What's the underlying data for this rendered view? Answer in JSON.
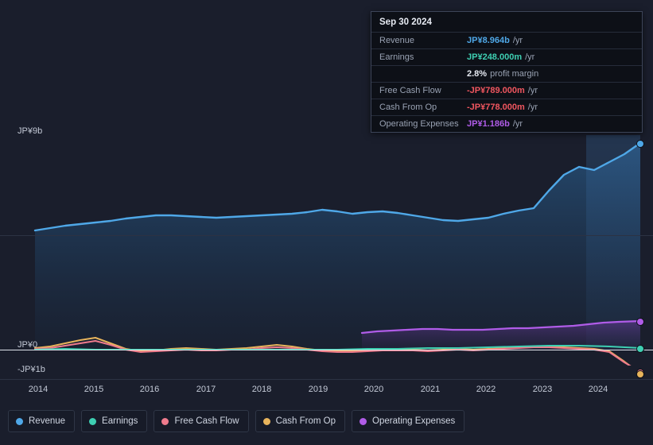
{
  "tooltip": {
    "date": "Sep 30 2024",
    "rows": [
      {
        "label": "Revenue",
        "value": "JP¥8.964b",
        "unit": "/yr",
        "color": "#4fa8e8"
      },
      {
        "label": "Earnings",
        "value": "JP¥248.000m",
        "unit": "/yr",
        "color": "#3ecfb2"
      },
      {
        "label": "",
        "value": "2.8%",
        "unit": "profit margin",
        "color": "#e6eaf2"
      },
      {
        "label": "Free Cash Flow",
        "value": "-JP¥789.000m",
        "unit": "/yr",
        "color": "#f0565f"
      },
      {
        "label": "Cash From Op",
        "value": "-JP¥778.000m",
        "unit": "/yr",
        "color": "#f0565f"
      },
      {
        "label": "Operating Expenses",
        "value": "JP¥1.186b",
        "unit": "/yr",
        "color": "#b05ce8"
      }
    ]
  },
  "axis": {
    "y_top": "JP¥9b",
    "y_zero": "JP¥0",
    "y_bottom": "-JP¥1b",
    "x_ticks": [
      "2014",
      "2015",
      "2016",
      "2017",
      "2018",
      "2019",
      "2020",
      "2021",
      "2022",
      "2023",
      "2024"
    ]
  },
  "legend": [
    {
      "label": "Revenue",
      "color": "#4fa8e8"
    },
    {
      "label": "Earnings",
      "color": "#3ecfb2"
    },
    {
      "label": "Free Cash Flow",
      "color": "#ef7b8d"
    },
    {
      "label": "Cash From Op",
      "color": "#e8b45c"
    },
    {
      "label": "Operating Expenses",
      "color": "#b05ce8"
    }
  ],
  "chart_data": {
    "type": "line",
    "title": "",
    "xlabel": "",
    "ylabel": "",
    "ylim": [
      -1000000000,
      9000000000
    ],
    "y_axis_ticks": [
      "JP¥9b",
      "JP¥0",
      "-JP¥1b"
    ],
    "grid": false,
    "legend_position": "bottom",
    "currency": "JP¥",
    "x": [
      "2014",
      "2015",
      "2016",
      "2017",
      "2018",
      "2019",
      "2020",
      "2021",
      "2022",
      "2023",
      "2024",
      "2024-09-30"
    ],
    "series": [
      {
        "name": "Revenue",
        "color": "#4fa8e8",
        "values": [
          4.85,
          5.05,
          5.3,
          5.25,
          5.35,
          5.45,
          5.5,
          5.45,
          5.35,
          5.9,
          7.6,
          8.964
        ],
        "unit": "JP¥b"
      },
      {
        "name": "Earnings",
        "color": "#3ecfb2",
        "values": [
          0.02,
          0.05,
          0.03,
          0.02,
          0.04,
          0.05,
          0.03,
          0.06,
          0.1,
          0.18,
          0.22,
          0.248
        ],
        "unit": "JP¥b"
      },
      {
        "name": "Free Cash Flow",
        "color": "#ef7b8d",
        "values": [
          0.05,
          0.12,
          -0.02,
          0.03,
          0.06,
          0.02,
          -0.05,
          0.1,
          0.05,
          0.12,
          0.08,
          -0.789
        ],
        "unit": "JP¥b"
      },
      {
        "name": "Cash From Op",
        "color": "#e8b45c",
        "values": [
          0.08,
          0.22,
          0.02,
          0.06,
          0.1,
          0.05,
          0.0,
          0.14,
          0.09,
          0.15,
          0.11,
          -0.778
        ],
        "unit": "JP¥b"
      },
      {
        "name": "Operating Expenses",
        "color": "#b05ce8",
        "values": [
          null,
          null,
          null,
          null,
          null,
          null,
          0.72,
          0.82,
          0.86,
          0.9,
          1.05,
          1.186
        ],
        "unit": "JP¥b",
        "starts_at": "2019-10"
      }
    ],
    "highlight_point": {
      "x": "2024-09-30",
      "label": "Sep 30 2024"
    }
  }
}
